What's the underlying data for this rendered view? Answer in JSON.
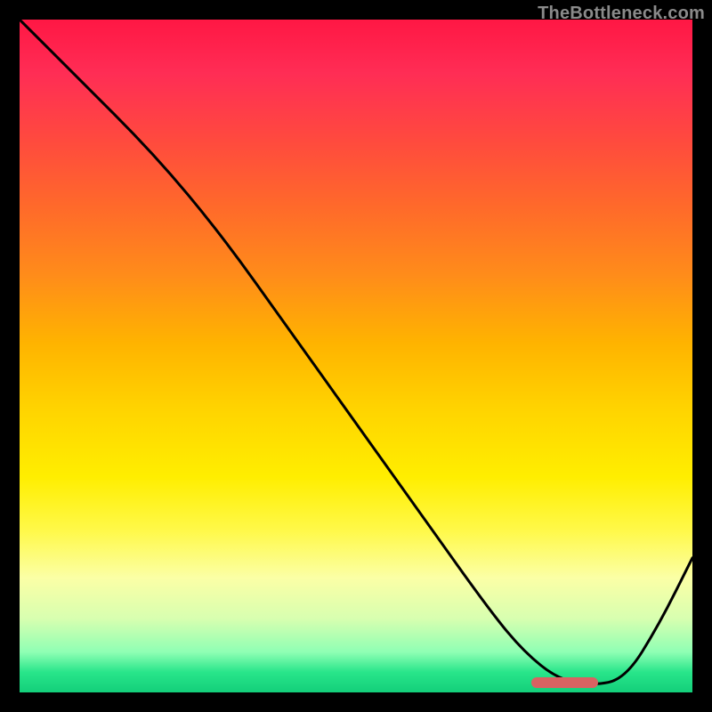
{
  "watermark": "TheBottleneck.com",
  "chart_data": {
    "type": "line",
    "title": "",
    "xlabel": "",
    "ylabel": "",
    "xlim": [
      0,
      100
    ],
    "ylim": [
      0,
      100
    ],
    "grid": false,
    "legend": false,
    "series": [
      {
        "name": "bottleneck-curve",
        "x": [
          0,
          8,
          20,
          30,
          40,
          50,
          60,
          70,
          75,
          80,
          85,
          90,
          95,
          100
        ],
        "values": [
          100,
          92,
          80,
          68,
          54,
          40,
          26,
          12,
          6,
          2,
          1,
          2,
          10,
          20
        ]
      }
    ],
    "optimal_range": {
      "start": 76,
      "end": 86
    },
    "background": "heatmap-vertical",
    "colors": {
      "curve": "#000000",
      "marker": "#d96262",
      "top": "#ff1744",
      "bottom": "#13cf7a"
    }
  }
}
